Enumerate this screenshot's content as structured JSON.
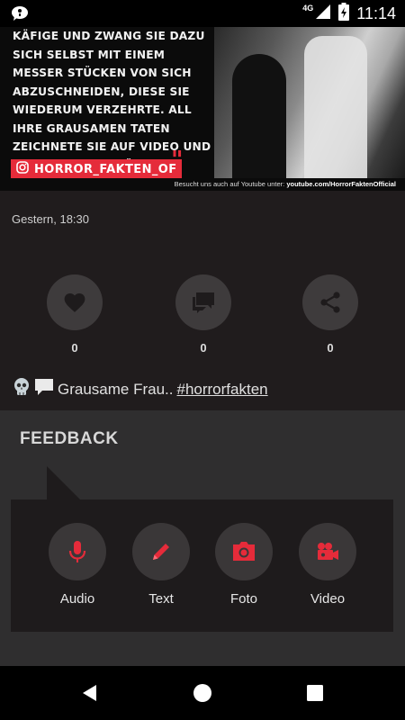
{
  "status_bar": {
    "time": "11:14",
    "network": "4G",
    "left_icon": "chat-ghost-icon",
    "icons": [
      "signal-icon",
      "battery-charging-icon"
    ]
  },
  "post": {
    "image_text": "Käfige und zwang sie dazu sich selbst mit einem Messer Stücken von sich abzuschneiden, diese sie wiederum verzehrte. All ihre grausamen Taten zeichnete sie auf Video und verkaufte sie höchst-wahrscheinlich im Deep Web.",
    "instagram_handle": "HORROR_FAKTEN_OF",
    "footer_prefix": "Besucht uns auch auf Youtube unter:",
    "footer_link": "youtube.com/HorrorFaktenOfficial",
    "timestamp": "Gestern, 18:30",
    "likes": "0",
    "comments": "0",
    "shares": "0",
    "caption_text": "Grausame Frau..",
    "hashtag": "#horrorfakten"
  },
  "feedback": {
    "title": "FEEDBACK",
    "buttons": [
      {
        "label": "Audio",
        "icon": "microphone-icon"
      },
      {
        "label": "Text",
        "icon": "pencil-icon"
      },
      {
        "label": "Foto",
        "icon": "camera-icon"
      },
      {
        "label": "Video",
        "icon": "video-camera-icon"
      }
    ]
  },
  "colors": {
    "accent": "#e52b3a",
    "background": "#201c1d",
    "panel": "#2f2e2f"
  }
}
